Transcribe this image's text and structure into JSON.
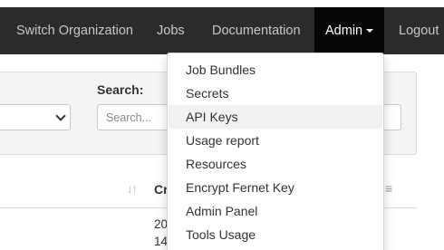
{
  "navbar": {
    "items": [
      {
        "label": "Switch Organization"
      },
      {
        "label": "Jobs"
      },
      {
        "label": "Documentation"
      },
      {
        "label": "Admin"
      },
      {
        "label": "Logout"
      }
    ]
  },
  "filters": {
    "search_label": "Search:",
    "search_placeholder": "Search..."
  },
  "table": {
    "header_partial": "Cr",
    "cell_lines": [
      "20",
      "14"
    ]
  },
  "admin_menu": {
    "items": [
      {
        "label": "Job Bundles"
      },
      {
        "label": "Secrets"
      },
      {
        "label": "API Keys",
        "highlighted": true
      },
      {
        "label": "Usage report"
      },
      {
        "label": "Resources"
      },
      {
        "label": "Encrypt Fernet Key"
      },
      {
        "label": "Admin Panel"
      },
      {
        "label": "Tools Usage"
      }
    ]
  },
  "colors": {
    "navbar_bg": "#2b2b2b",
    "navbar_active_bg": "#060606",
    "menu_hover_bg": "#f2f2f2"
  }
}
